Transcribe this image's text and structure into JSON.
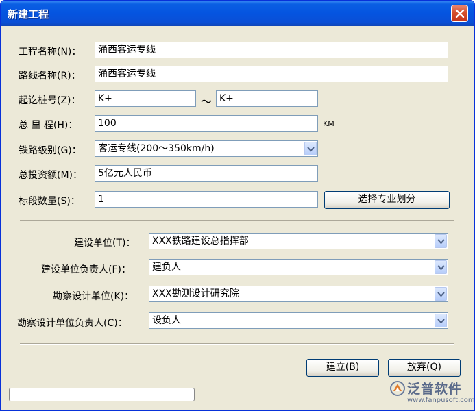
{
  "window": {
    "title": "新建工程"
  },
  "form": {
    "project_name": {
      "label": "工程名称(N)：",
      "value": "涌西客运专线"
    },
    "route_name": {
      "label": "路线名称(R)：",
      "value": "涌西客运专线"
    },
    "station": {
      "label": "起讫桩号(Z)：",
      "start": "K+",
      "separator": "～",
      "end": "K+"
    },
    "mileage": {
      "label": "总 里 程(H)：",
      "value": "100",
      "unit": "KM"
    },
    "railway_grade": {
      "label": "铁路级别(G)：",
      "value": "客运专线(200～350km/h)"
    },
    "investment": {
      "label": "总投资额(M)：",
      "value": "5亿元人民币"
    },
    "section_count": {
      "label": "标段数量(S)：",
      "value": "1",
      "button": "选择专业划分"
    }
  },
  "units": {
    "construction_unit": {
      "label": "建设单位(T)：",
      "value": "XXX铁路建设总指挥部"
    },
    "construction_lead": {
      "label": "建设单位负责人(F)：",
      "value": "建负人"
    },
    "survey_unit": {
      "label": "勘察设计单位(K)：",
      "value": "XXX勘测设计研究院"
    },
    "survey_lead": {
      "label": "勘察设计单位负责人(C)：",
      "value": "设负人"
    }
  },
  "buttons": {
    "create": "建立(B)",
    "abandon": "放弃(Q)"
  },
  "brand": {
    "name": "泛普软件",
    "url": "www.fanpusoft.com"
  }
}
